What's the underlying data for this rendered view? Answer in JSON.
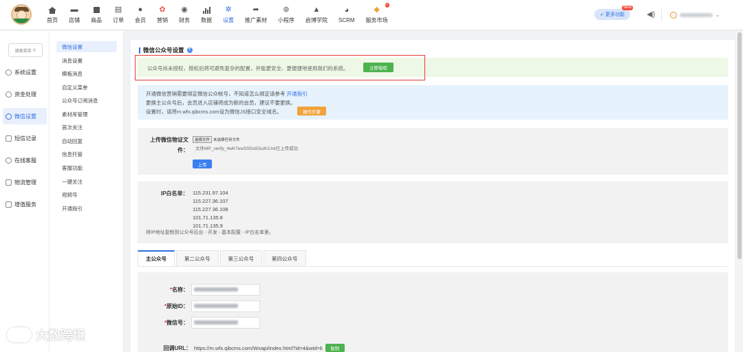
{
  "nav": {
    "items": [
      {
        "label": "首页",
        "icon": "home-icon"
      },
      {
        "label": "店铺",
        "icon": "store-icon"
      },
      {
        "label": "商品",
        "icon": "goods-icon"
      },
      {
        "label": "订单",
        "icon": "order-icon"
      },
      {
        "label": "会员",
        "icon": "member-icon"
      },
      {
        "label": "营销",
        "icon": "marketing-icon"
      },
      {
        "label": "财务",
        "icon": "finance-icon"
      },
      {
        "label": "数据",
        "icon": "data-chart-icon"
      },
      {
        "label": "设置",
        "icon": "settings-icon"
      },
      {
        "label": "推广素材",
        "icon": "share-icon"
      },
      {
        "label": "小程序",
        "icon": "miniprogram-icon"
      },
      {
        "label": "启博学院",
        "icon": "graduation-cap-icon"
      },
      {
        "label": "SCRM",
        "icon": "pie-chart-icon"
      },
      {
        "label": "服务市场",
        "icon": "diamond-icon"
      }
    ],
    "more_label": "更多功能",
    "new_badge": "NEW",
    "accent": "#2f6fe4"
  },
  "side1": {
    "search_placeholder": "搜索菜单",
    "items": [
      "系统设置",
      "资金处理",
      "微信设置",
      "短信记录",
      "在线客服",
      "物流管理",
      "增值服务"
    ]
  },
  "side2": {
    "items": [
      "微信设置",
      "消息设置",
      "模板消息",
      "自定义菜单",
      "公众号订阅消息",
      "素材库管理",
      "首次关注",
      "自动回复",
      "信息托管",
      "客服功能",
      "一键关注",
      "视频号",
      "开通指引"
    ]
  },
  "main": {
    "title": "微信公众号设置",
    "warn_text": "公众号尚未授权，授权后将可避免复杂的配置，并能更安全、更便捷地使用我们的系统。",
    "auth_button": "立即授权",
    "info1_text": "开通微信营销需要绑定微信公众帐号，不知道怎么绑定请参考 ",
    "info1_link": "开通指引",
    "info2": "更换主公众号后，会员进入店铺将成为新的会员，建议不要更换。",
    "info3": "设置时，请将m.wfx.qibcms.com设为微信JS接口安全域名。",
    "op_button": "操作步骤",
    "upload_label1": "上传微信物证文",
    "upload_label2": "件：",
    "choose_file": "选择文件",
    "no_file": "未选择任何文件",
    "upload_status": "文件MP_verify_4wK7ewSSGs5SuiK3.txt已上传成功",
    "upload_button": "上传",
    "ip_label": "IP白名单：",
    "ips": [
      "115.231.97.104",
      "115.227.36.107",
      "115.227.36.108",
      "101.71.135.8",
      "101.71.135.9"
    ],
    "ip_hint": "将IP地址复制到公众号后台 - 开发 - 基本配置 - IP白名单里。",
    "tabs": [
      "主公众号",
      "第二公众号",
      "第三公众号",
      "第四公众号"
    ],
    "form": {
      "name_label": "名称：",
      "orig_label": "原始ID：",
      "wx_label": "微信号：",
      "url_label": "回调URL：",
      "url_value": "https://m.wfx.qibcms.com/Wxapi/index.html?id=4&wid=6",
      "copy_button": "复制"
    }
  },
  "watermark": "大数跨境"
}
